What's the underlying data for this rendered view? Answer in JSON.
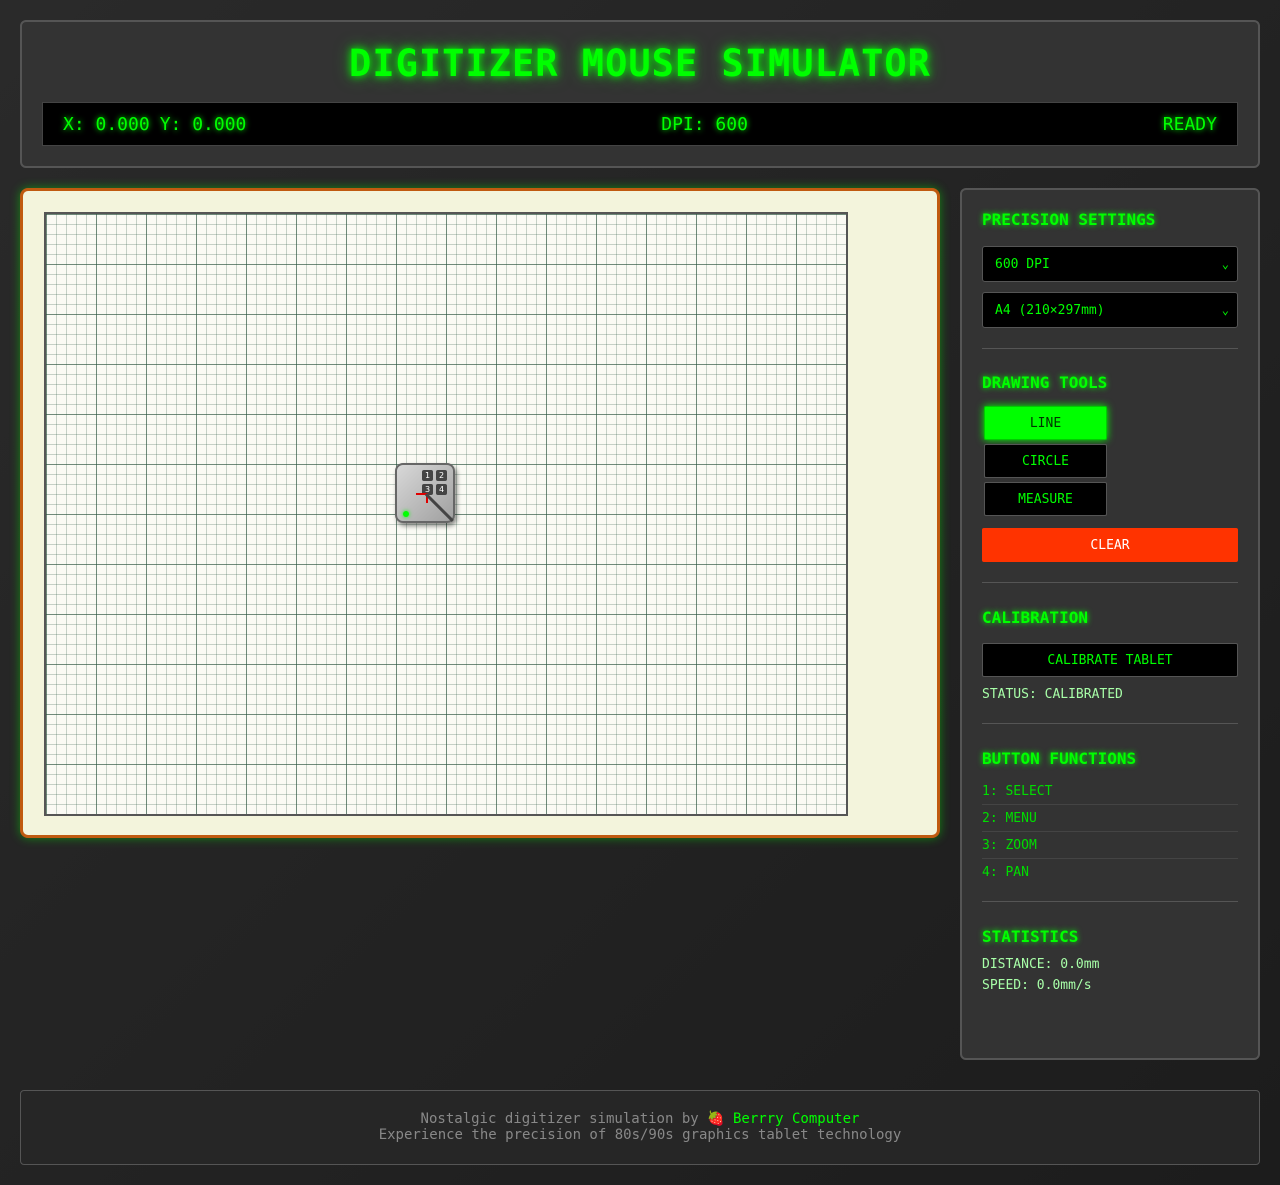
{
  "header": {
    "title": "DIGITIZER MOUSE SIMULATOR",
    "status": {
      "x_label": "X: 0.000",
      "y_label": "Y: 0.000",
      "dpi_label": "DPI: 600",
      "state": "READY"
    }
  },
  "puck": {
    "buttons": [
      "1",
      "2",
      "3",
      "4"
    ]
  },
  "panel": {
    "precision": {
      "title": "PRECISION SETTINGS",
      "dpi_value": "600 DPI",
      "size_value": "A4 (210×297mm)"
    },
    "tools": {
      "title": "DRAWING TOOLS",
      "items": [
        {
          "label": "LINE",
          "active": true
        },
        {
          "label": "CIRCLE",
          "active": false
        },
        {
          "label": "MEASURE",
          "active": false
        }
      ],
      "clear_label": "CLEAR"
    },
    "calibration": {
      "title": "CALIBRATION",
      "button_label": "CALIBRATE TABLET",
      "status": "STATUS: CALIBRATED"
    },
    "functions": {
      "title": "BUTTON FUNCTIONS",
      "items": [
        "1: SELECT",
        "2: MENU",
        "3: ZOOM",
        "4: PAN"
      ]
    },
    "statistics": {
      "title": "STATISTICS",
      "distance": "DISTANCE: 0.0mm",
      "speed": "SPEED: 0.0mm/s"
    }
  },
  "footer": {
    "line1_prefix": "Nostalgic digitizer simulation by ",
    "brand_icon": "🍓",
    "brand": "Berrry Computer",
    "line2": "Experience the precision of 80s/90s graphics tablet technology"
  },
  "colors": {
    "accent": "#00ff00",
    "danger": "#ff3300",
    "tablet_border": "#c05a10"
  }
}
